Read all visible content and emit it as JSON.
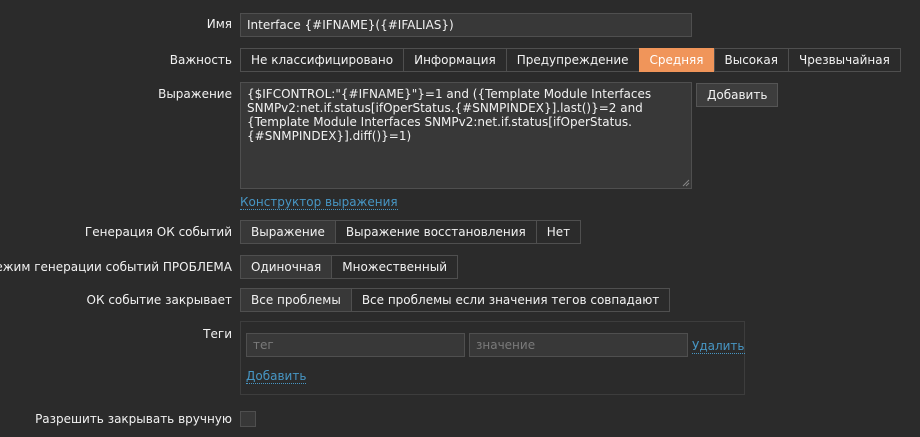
{
  "fields": {
    "name": {
      "label": "Имя",
      "value": "Interface {#IFNAME}({#IFALIAS})"
    },
    "severity": {
      "label": "Важность",
      "options": [
        "Не классифицировано",
        "Информация",
        "Предупреждение",
        "Средняя",
        "Высокая",
        "Чрезвычайная"
      ],
      "selected": "Средняя"
    },
    "expression": {
      "label": "Выражение",
      "value": "{$IFCONTROL:\"{#IFNAME}\"}=1 and ({Template Module Interfaces SNMPv2:net.if.status[ifOperStatus.{#SNMPINDEX}].last()}=2 and {Template Module Interfaces SNMPv2:net.if.status[ifOperStatus.{#SNMPINDEX}].diff()}=1)",
      "add_button": "Добавить",
      "constructor_link": "Конструктор выражения"
    },
    "ok_event_generation": {
      "label": "Генерация ОК событий",
      "options": [
        "Выражение",
        "Выражение восстановления",
        "Нет"
      ],
      "selected": "Выражение"
    },
    "problem_mode": {
      "label": "Режим генерации событий ПРОБЛЕМА",
      "options": [
        "Одиночная",
        "Множественный"
      ],
      "selected": "Одиночная"
    },
    "ok_closes": {
      "label": "ОК событие закрывает",
      "options": [
        "Все проблемы",
        "Все проблемы если значения тегов совпадают"
      ],
      "selected": "Все проблемы"
    },
    "tags": {
      "label": "Теги",
      "tag_placeholder": "тег",
      "value_placeholder": "значение",
      "remove_link": "Удалить",
      "add_link": "Добавить"
    },
    "manual_close": {
      "label": "Разрешить закрывать вручную",
      "checked": false
    }
  },
  "colors": {
    "background": "#2b2b2b",
    "severity_average": "#f0955a",
    "link": "#4796c4"
  }
}
